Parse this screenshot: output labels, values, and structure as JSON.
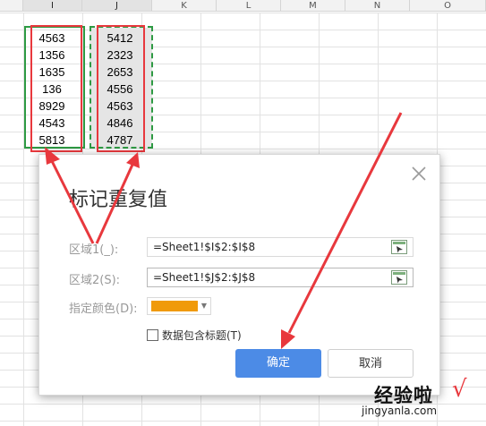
{
  "spreadsheet": {
    "col_headers": [
      "I",
      "J",
      "K",
      "L",
      "M",
      "N",
      "O"
    ],
    "col_i_values": [
      "4563",
      "1356",
      "1635",
      "136",
      "8929",
      "4543",
      "5813"
    ],
    "col_j_values": [
      "5412",
      "2323",
      "2653",
      "4556",
      "4563",
      "4846",
      "4787"
    ]
  },
  "dialog": {
    "title": "标记重复值",
    "range1_label": "区域1(_):",
    "range1_value": "=Sheet1!$I$2:$I$8",
    "range2_label": "区域2(S):",
    "range2_value": "=Sheet1!$J$2:$J$8",
    "color_label": "指定颜色(D):",
    "color_value": "#f09a0a",
    "include_header_label": "数据包含标题(T)",
    "include_header_checked": false,
    "ok_label": "确定",
    "cancel_label": "取消"
  },
  "annotation_color": "#e8383d",
  "watermark": {
    "main": "经验啦",
    "check": "√",
    "url": "jingyanla.com"
  }
}
